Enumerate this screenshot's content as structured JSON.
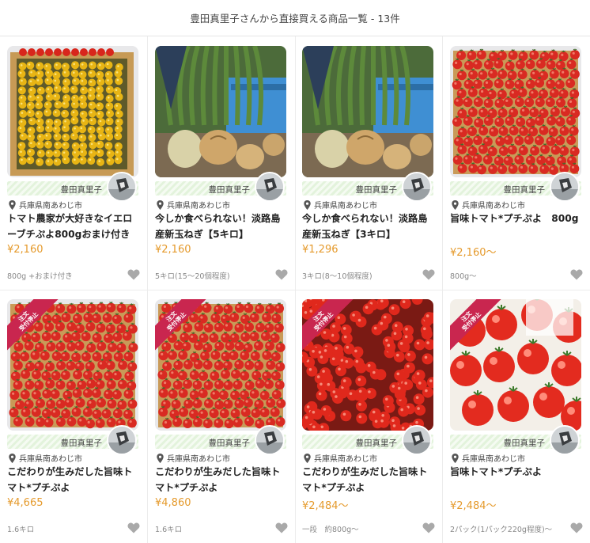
{
  "header": {
    "title": "豊田真里子さんから直接買える商品一覧 - 13件"
  },
  "products": [
    {
      "producer": "豊田真里子",
      "location": "兵庫県南あわじ市",
      "title": "トマト農家が大好きなイエローブチぷよ800gおまけ付き",
      "price": "¥2,160",
      "spec": "800g +おまけ付き",
      "photo": "yellow-tomatoes-box",
      "badge": null
    },
    {
      "producer": "豊田真里子",
      "location": "兵庫県南あわじ市",
      "title": "今しか食べられない！淡路島産新玉ねぎ【5キロ】",
      "price": "¥2,160",
      "spec": "5キロ(15〜20個程度)",
      "photo": "onions-field",
      "badge": null
    },
    {
      "producer": "豊田真里子",
      "location": "兵庫県南あわじ市",
      "title": "今しか食べられない！淡路島産新玉ねぎ【3キロ】",
      "price": "¥1,296",
      "spec": "3キロ(8〜10個程度)",
      "photo": "onions-field",
      "badge": null
    },
    {
      "producer": "豊田真里子",
      "location": "兵庫県南あわじ市",
      "title": "旨味トマト*プチぷよ　800g",
      "price": "¥2,160〜",
      "spec": "800g〜",
      "photo": "red-tomatoes-box",
      "badge": null
    },
    {
      "producer": "豊田真里子",
      "location": "兵庫県南あわじ市",
      "title": "こだわりが生みだした旨味トマト*プチぷよ",
      "price": "¥4,665",
      "spec": "1.6キロ",
      "photo": "red-tomatoes-box",
      "badge": {
        "line1": "注文",
        "line2": "受付停止"
      }
    },
    {
      "producer": "豊田真里子",
      "location": "兵庫県南あわじ市",
      "title": "こだわりが生みだした旨味トマト*プチぷよ",
      "price": "¥4,860",
      "spec": "1.6キロ",
      "photo": "red-tomatoes-box",
      "badge": {
        "line1": "注文",
        "line2": "受付停止"
      }
    },
    {
      "producer": "豊田真里子",
      "location": "兵庫県南あわじ市",
      "title": "こだわりが生みだした旨味トマト*プチぷよ",
      "price": "¥2,484〜",
      "spec": "一段　約800g〜",
      "photo": "red-tomatoes-loose",
      "badge": {
        "line1": "注文",
        "line2": "受付停止"
      }
    },
    {
      "producer": "豊田真里子",
      "location": "兵庫県南あわじ市",
      "title": "旨味トマト*プチぷよ",
      "price": "¥2,484〜",
      "spec": "2パック(1パック220g程度)〜",
      "photo": "tomatoes-pack-closeup",
      "badge": {
        "line1": "注文",
        "line2": "受付停止"
      }
    }
  ],
  "colors": {
    "price": "#e59a2c",
    "badge": "#c9264f",
    "producer_strip": "#e3f3dc",
    "heart": "#a9a9a9"
  },
  "icons": {
    "location": "map-pin-icon",
    "favorite": "heart-icon"
  }
}
